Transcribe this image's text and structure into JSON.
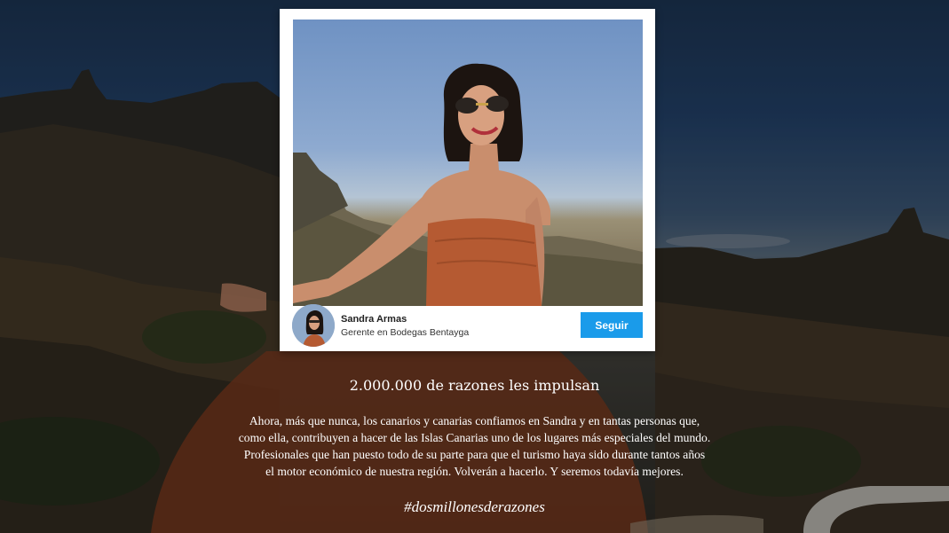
{
  "colors": {
    "follow_button": "#1a9bea",
    "text": "#ffffff",
    "card": "#ffffff"
  },
  "post": {
    "author_name": "Sandra Armas",
    "author_role": "Gerente en Bodegas Bentayga",
    "follow_label": "Seguir"
  },
  "headline": "2.000.000 de razones les impulsan",
  "body_lines": [
    "Ahora, más que nunca, los canarios y canarias confiamos en Sandra y en tantas personas que,",
    "como ella, contribuyen a hacer de las Islas Canarias uno de los lugares más especiales del mundo.",
    "Profesionales que han puesto todo de su parte para que el turismo haya sido durante tantos años",
    "el motor económico de nuestra región. Volverán a hacerlo. Y seremos todavía mejores."
  ],
  "hashtag": "#dosmillonesderazones"
}
